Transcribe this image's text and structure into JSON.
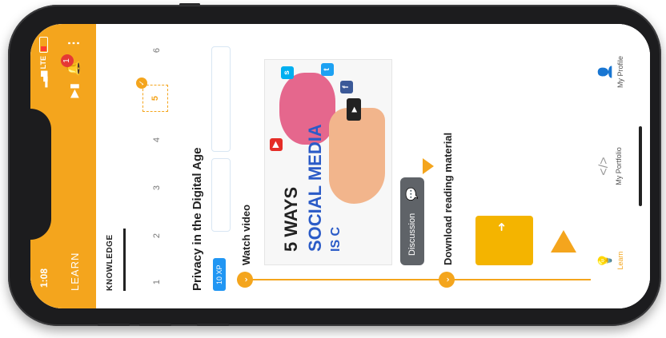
{
  "status_bar": {
    "time": "1:08",
    "network": "LTE",
    "signal_icon": "signal-icon",
    "battery_icon": "battery-icon"
  },
  "header": {
    "title": "LEARN",
    "notification_count": "1",
    "icons": [
      "video-icon",
      "bell-icon",
      "more-icon"
    ]
  },
  "tabs": [
    {
      "label": "KNOWLEDGE",
      "active": true
    },
    {
      "label": "",
      "active": false
    },
    {
      "label": "",
      "active": false
    },
    {
      "label": "",
      "active": false
    }
  ],
  "steps": [
    "1",
    "2",
    "3",
    "4",
    "5",
    "6"
  ],
  "current_step": "5",
  "lesson": {
    "title": "Privacy in the Digital Age",
    "xp": "10 XP"
  },
  "video_section": {
    "title": "Watch video",
    "thumbnail": {
      "line1": "5 WAYS",
      "line2": "SOCIAL MEDIA",
      "line3": "IS C",
      "caption": ""
    },
    "discussion_label": "Discussion"
  },
  "download_section": {
    "title": "Download reading material"
  },
  "bottom_nav": [
    {
      "label": "Learn",
      "icon": "bulb-icon",
      "active": true
    },
    {
      "label": "My Portfolio",
      "icon": "code-icon",
      "active": false
    },
    {
      "label": "My Profile",
      "icon": "profile-icon",
      "active": false
    }
  ],
  "colors": {
    "accent": "#f4a51d",
    "xp_badge": "#2196f3",
    "discussion_bg": "#5f6368",
    "phone": "#1c1c1e"
  }
}
